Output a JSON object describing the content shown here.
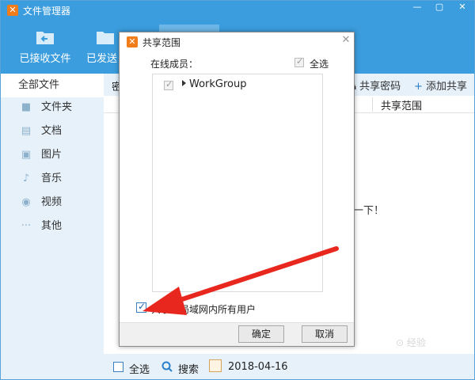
{
  "window": {
    "title": "文件管理器",
    "icon": "app-logo-icon",
    "controls": [
      "minimize-icon",
      "maximize-icon",
      "close-icon"
    ]
  },
  "toolbar": {
    "items": [
      {
        "label": "已接收文件",
        "icon": "folder-receive-icon"
      },
      {
        "label": "已发送",
        "icon": "folder-send-icon"
      }
    ]
  },
  "sidebar": {
    "header": "全部文件",
    "items": [
      {
        "label": "文件夹",
        "icon": "folder-icon"
      },
      {
        "label": "文档",
        "icon": "document-icon"
      },
      {
        "label": "图片",
        "icon": "image-icon"
      },
      {
        "label": "音乐",
        "icon": "music-icon"
      },
      {
        "label": "视频",
        "icon": "video-icon"
      },
      {
        "label": "其他",
        "icon": "more-icon"
      }
    ]
  },
  "content": {
    "header_partial": "密",
    "share_password": "共享密码",
    "add_share": "添加共享",
    "column_share_range": "共享范围",
    "empty_message_partial": "一下！"
  },
  "bottom_bar": {
    "select_all": "全选",
    "search": "搜索",
    "date": "2018-04-16"
  },
  "dialog": {
    "title": "共享范围",
    "online_members_label": "在线成员：",
    "select_all_label": "全选",
    "select_all_checked": true,
    "group": {
      "label": "WorkGroup",
      "checked": true
    },
    "share_all_lan_label": "共享给局域网内所有用户",
    "share_all_lan_checked": true,
    "ok": "确定",
    "cancel": "取消"
  },
  "annotation": {
    "arrow_color": "#e8281e"
  },
  "colors": {
    "title_bar": "#3b9ddd",
    "sidebar_bg": "#e6f1fa",
    "app_icon": "#f07c1a"
  }
}
